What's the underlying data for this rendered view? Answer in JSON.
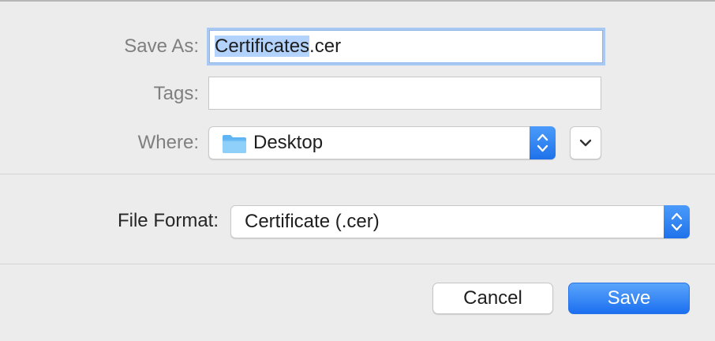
{
  "save_as": {
    "label": "Save As:",
    "filename_selected": "Certificates",
    "filename_extension": ".cer"
  },
  "tags": {
    "label": "Tags:",
    "value": ""
  },
  "where": {
    "label": "Where:",
    "value": "Desktop",
    "icon": "folder-icon"
  },
  "file_format": {
    "label": "File Format:",
    "value": "Certificate (.cer)"
  },
  "buttons": {
    "cancel": "Cancel",
    "save": "Save"
  },
  "colors": {
    "accent": "#1f72ea",
    "selection": "#b3d3fd",
    "background": "#ececec"
  }
}
